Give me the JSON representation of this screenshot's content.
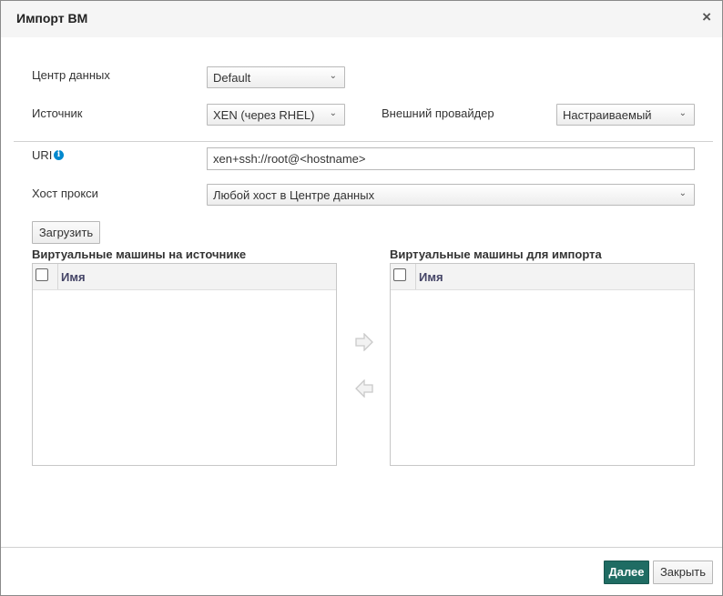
{
  "dialog": {
    "title": "Импорт ВМ",
    "close_glyph": "×"
  },
  "form": {
    "datacenter": {
      "label": "Центр данных",
      "value": "Default"
    },
    "source": {
      "label": "Источник",
      "value": "XEN (через RHEL)"
    },
    "external_provider": {
      "label": "Внешний провайдер",
      "value": "Настраиваемый"
    },
    "uri": {
      "label": "URI",
      "value": "xen+ssh://root@<hostname>"
    },
    "proxy_host": {
      "label": "Хост прокси",
      "value": "Любой хост в Центре данных"
    },
    "load_button": "Загрузить"
  },
  "source_vms": {
    "title": "Виртуальные машины на источнике",
    "column": "Имя",
    "rows": []
  },
  "import_vms": {
    "title": "Виртуальные машины для импорта",
    "column": "Имя",
    "rows": []
  },
  "footer": {
    "next_button": "Далее",
    "close_button": "Закрыть"
  },
  "colors": {
    "primary_button": "#1f6c63",
    "info_icon": "#0088ce"
  },
  "icons": {
    "info": "info-icon",
    "move_right": "arrow-right-icon",
    "move_left": "arrow-left-icon",
    "dropdown": "chevron-down-icon",
    "close": "close-icon"
  }
}
